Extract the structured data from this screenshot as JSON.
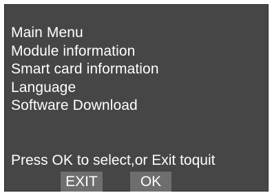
{
  "menu": {
    "items": [
      {
        "label": "Main Menu"
      },
      {
        "label": "Module information"
      },
      {
        "label": "Smart card information"
      },
      {
        "label": "Language"
      },
      {
        "label": "Software Download"
      }
    ]
  },
  "footer": {
    "prompt": "Press OK to select,or Exit toquit",
    "exit_label": "EXIT",
    "ok_label": "OK"
  },
  "colors": {
    "screen_background": "#464646",
    "button_background": "#6e6e6e",
    "text": "#ffffff"
  }
}
